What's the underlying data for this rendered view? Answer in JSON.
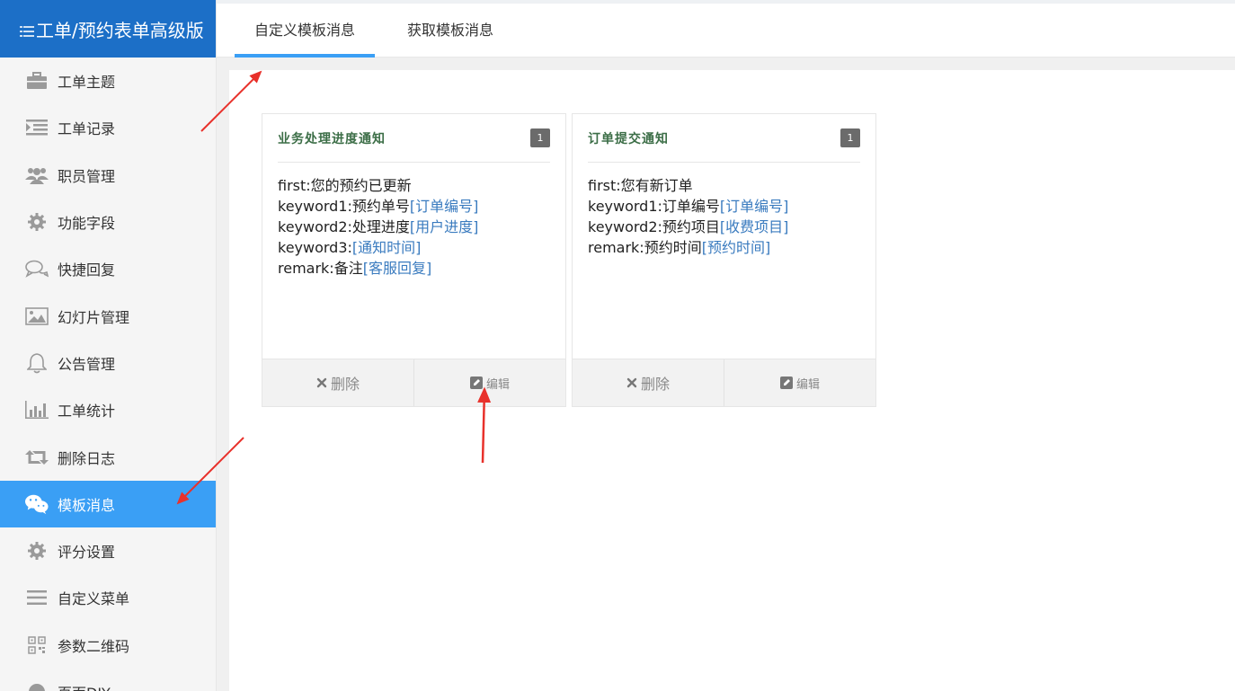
{
  "app": {
    "title": "工单/预约表单高级版",
    "title_icon": "list-icon"
  },
  "sidebar": {
    "items": [
      {
        "label": "工单主题",
        "icon": "briefcase-icon",
        "active": false
      },
      {
        "label": "工单记录",
        "icon": "list-indent-icon",
        "active": false
      },
      {
        "label": "职员管理",
        "icon": "users-icon",
        "active": false
      },
      {
        "label": "功能字段",
        "icon": "gear-icon",
        "active": false
      },
      {
        "label": "快捷回复",
        "icon": "chat-bubbles-icon",
        "active": false
      },
      {
        "label": "幻灯片管理",
        "icon": "image-icon",
        "active": false
      },
      {
        "label": "公告管理",
        "icon": "bell-icon",
        "active": false
      },
      {
        "label": "工单统计",
        "icon": "bar-chart-icon",
        "active": false
      },
      {
        "label": "删除日志",
        "icon": "retweet-icon",
        "active": false
      },
      {
        "label": "模板消息",
        "icon": "wechat-icon",
        "active": true
      },
      {
        "label": "评分设置",
        "icon": "gear-icon",
        "active": false
      },
      {
        "label": "自定义菜单",
        "icon": "menu-icon",
        "active": false
      },
      {
        "label": "参数二维码",
        "icon": "qrcode-icon",
        "active": false
      },
      {
        "label": "页面DIY",
        "icon": "paint-icon",
        "active": false
      }
    ],
    "active_color": "#3a9ff5",
    "header_color": "#1c6fc7"
  },
  "tabs": [
    {
      "label": "自定义模板消息",
      "active": true
    },
    {
      "label": "获取模板消息",
      "active": false
    }
  ],
  "cards": [
    {
      "title": "业务处理进度通知",
      "badge": "1",
      "lines": [
        {
          "text": "first:您的预约已更新",
          "placeholder": ""
        },
        {
          "text": "keyword1:预约单号",
          "placeholder": "[订单编号]"
        },
        {
          "text": "keyword2:处理进度",
          "placeholder": "[用户进度]"
        },
        {
          "text": "keyword3:",
          "placeholder": "[通知时间]"
        },
        {
          "text": "remark:备注",
          "placeholder": "[客服回复]"
        }
      ],
      "delete_label": "删除",
      "edit_label": "编辑"
    },
    {
      "title": "订单提交通知",
      "badge": "1",
      "lines": [
        {
          "text": "first:您有新订单",
          "placeholder": ""
        },
        {
          "text": "keyword1:订单编号",
          "placeholder": "[订单编号]"
        },
        {
          "text": "keyword2:预约项目",
          "placeholder": "[收费项目]"
        },
        {
          "text": "remark:预约时间",
          "placeholder": "[预约时间]"
        }
      ],
      "delete_label": "删除",
      "edit_label": "编辑"
    }
  ]
}
